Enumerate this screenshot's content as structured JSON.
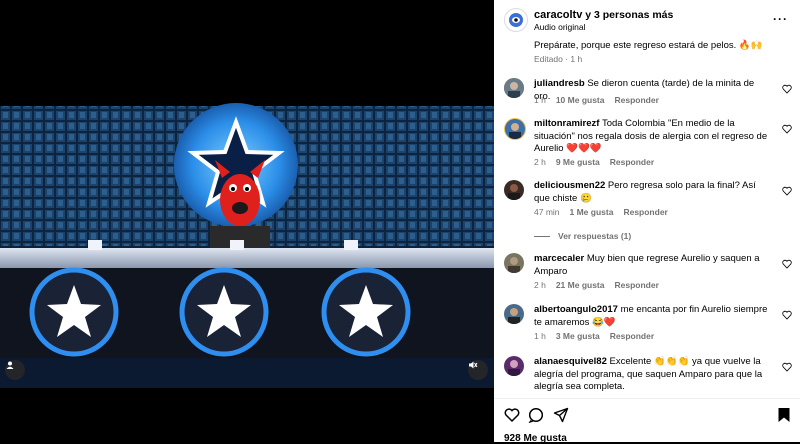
{
  "header": {
    "title_user": "caracoltv",
    "title_rest": " y 3 personas más",
    "subtitle": "Audio original",
    "more_icon": "more-horizontal-icon"
  },
  "caption": {
    "text": "Prepárate, porque este regreso estará de pelos. 🔥🙌",
    "edited": "Editado",
    "time": "1 h"
  },
  "comments": [
    {
      "user": "juliandresb",
      "text": "Se dieron cuenta (tarde) de la minita de oro.",
      "time": "1 h",
      "likes": "10 Me gusta",
      "reply": "Responder"
    },
    {
      "user": "miltonramirezf",
      "text": "Toda Colombia \"En medio de la situación\" nos regala dosis de alergia con el regreso de Aurelio ❤️❤️❤️",
      "time": "2 h",
      "likes": "9 Me gusta",
      "reply": "Responder"
    },
    {
      "user": "deliciousmen22",
      "text": "Pero regresa solo para la final? Así que chiste 🥲",
      "time": "47 min",
      "likes": "1 Me gusta",
      "reply": "Responder",
      "replies": "Ver respuestas (1)"
    },
    {
      "user": "marcecaler",
      "text": "Muy bien que regrese Aurelio y saquen a Amparo",
      "time": "2 h",
      "likes": "21 Me gusta",
      "reply": "Responder"
    },
    {
      "user": "albertoangulo2017",
      "text": "me encanta por fin Aurelio siempre te amaremos 😂❤️",
      "time": "1 h",
      "likes": "3 Me gusta",
      "reply": "Responder"
    },
    {
      "user": "alanaesquivel82",
      "text": "Excelente 👏👏👏 ya que vuelve la alegría del programa, que saquen Amparo para que la alegría sea completa.",
      "time": "",
      "likes": "",
      "reply": ""
    }
  ],
  "actions": {
    "likes": "928 Me gusta",
    "icons": [
      "heart-icon",
      "comment-icon",
      "share-icon",
      "bookmark-icon"
    ]
  },
  "colors": {
    "accent": "#0095f6",
    "muted": "#737373",
    "stage_blue": "#3aa0ff",
    "mascot_red": "#e0201c"
  }
}
